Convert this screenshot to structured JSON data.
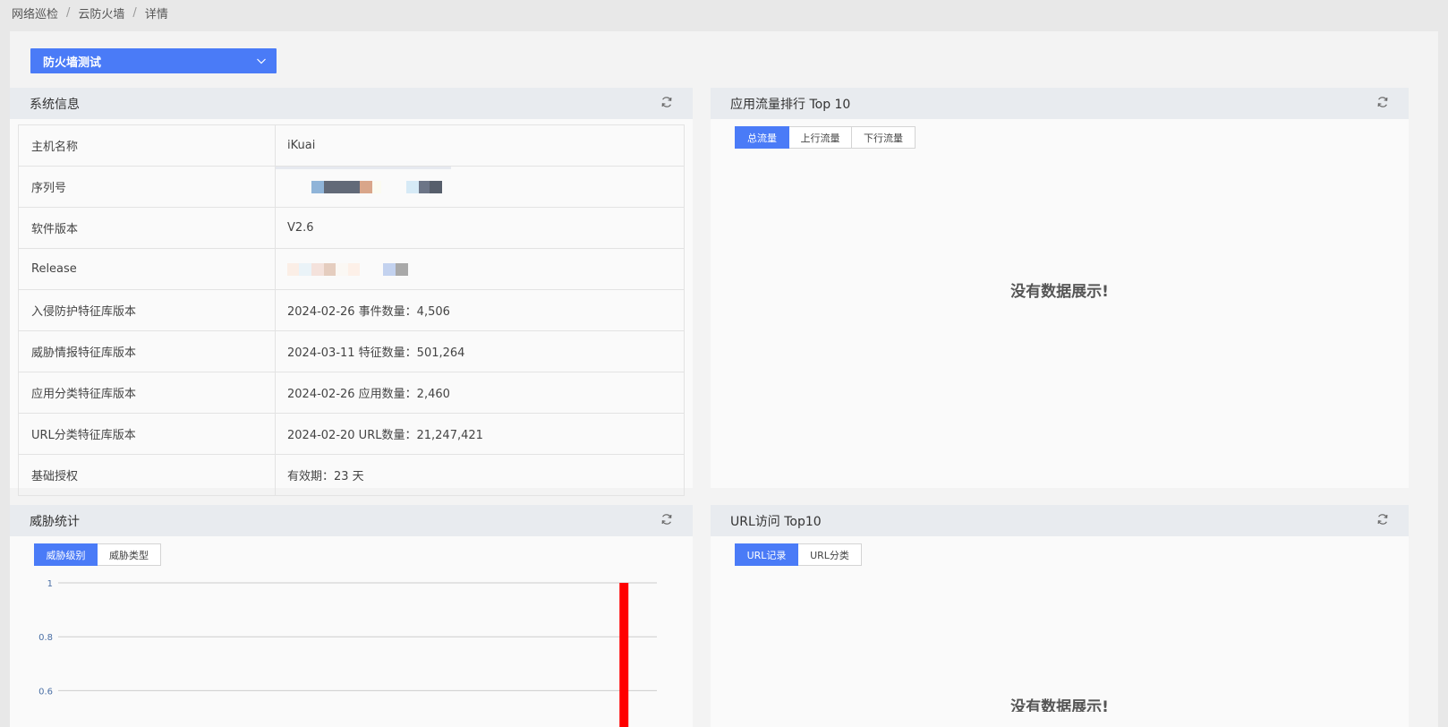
{
  "breadcrumb": {
    "items": [
      "网络巡检",
      "云防火墙",
      "详情"
    ]
  },
  "device_select": {
    "value": "防火墙测试"
  },
  "system_info": {
    "title": "系统信息",
    "rows": [
      {
        "key": "主机名称",
        "value": "iKuai"
      },
      {
        "key": "序列号",
        "value": ""
      },
      {
        "key": "软件版本",
        "value": "V2.6"
      },
      {
        "key": "Release",
        "value": ""
      },
      {
        "key": "入侵防护特征库版本",
        "value": "2024-02-26 事件数量：4,506"
      },
      {
        "key": "威胁情报特征库版本",
        "value": "2024-03-11 特征数量：501,264"
      },
      {
        "key": "应用分类特征库版本",
        "value": "2024-02-26 应用数量：2,460"
      },
      {
        "key": "URL分类特征库版本",
        "value": "2024-02-20 URL数量：21,247,421"
      },
      {
        "key": "基础授权",
        "value": "有效期：23 天"
      }
    ]
  },
  "app_traffic": {
    "title": "应用流量排行 Top 10",
    "tabs": [
      "总流量",
      "上行流量",
      "下行流量"
    ],
    "active_tab": 0,
    "empty_text": "没有数据展示!"
  },
  "threat_stats": {
    "title": "威胁统计",
    "tabs": [
      "威胁级别",
      "威胁类型"
    ],
    "active_tab": 0
  },
  "url_top": {
    "title": "URL访问 Top10",
    "tabs": [
      "URL记录",
      "URL分类"
    ],
    "active_tab": 0,
    "empty_text": "没有数据展示!"
  },
  "colors": {
    "accent": "#4a7bf7",
    "bar": "#ff0000"
  },
  "chart_data": {
    "type": "bar",
    "y_ticks": [
      "1",
      "0.8",
      "0.6"
    ],
    "ylim": [
      0,
      1
    ],
    "values": [
      1
    ],
    "bar_position": 0.945,
    "grid": true
  }
}
